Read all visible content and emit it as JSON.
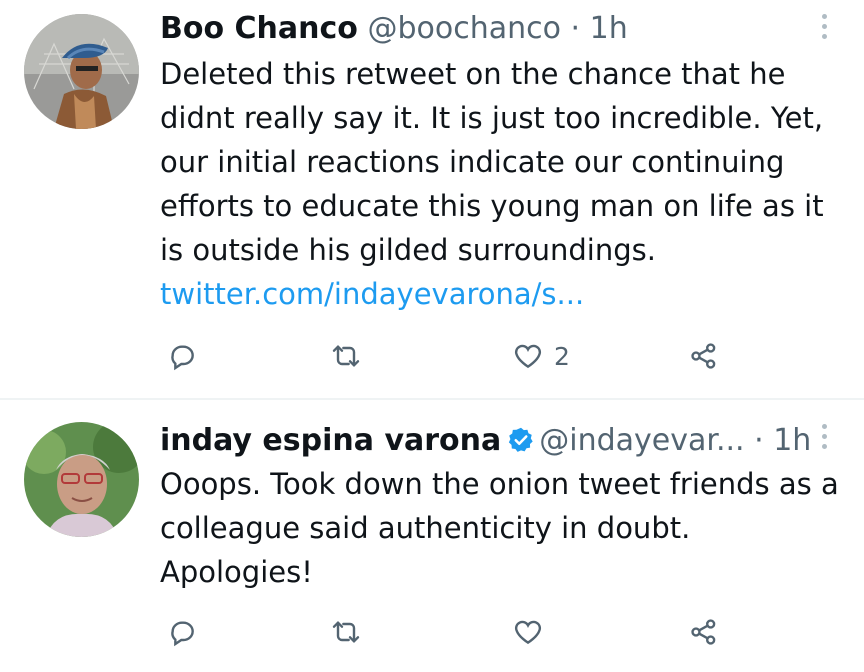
{
  "tweets": [
    {
      "name": "Boo Chanco",
      "handle": "@boochanco",
      "separator": "·",
      "time": "1h",
      "text": "Deleted this retweet on the chance that he didnt really say it. It is just too incredible. Yet, our initial reactions indicate our continuing efforts to educate this young man on life as it is outside his gilded surroundings.",
      "link": "twitter.com/indayevarona/s...",
      "like_count": "2",
      "verified": false
    },
    {
      "name": "inday espina varona",
      "handle": "@indayevar...",
      "separator": "·",
      "time": "1h",
      "text": "Ooops. Took down the onion tweet friends as a colleague said authenticity in doubt. Apologies!",
      "link": "",
      "like_count": "",
      "verified": true
    }
  ],
  "colors": {
    "text": "#0f1419",
    "secondary": "#536471",
    "link": "#1d9bf0",
    "divider": "#eff3f4"
  },
  "icons": [
    "reply-icon",
    "retweet-icon",
    "like-icon",
    "share-icon",
    "more-icon",
    "verified-badge-icon"
  ]
}
